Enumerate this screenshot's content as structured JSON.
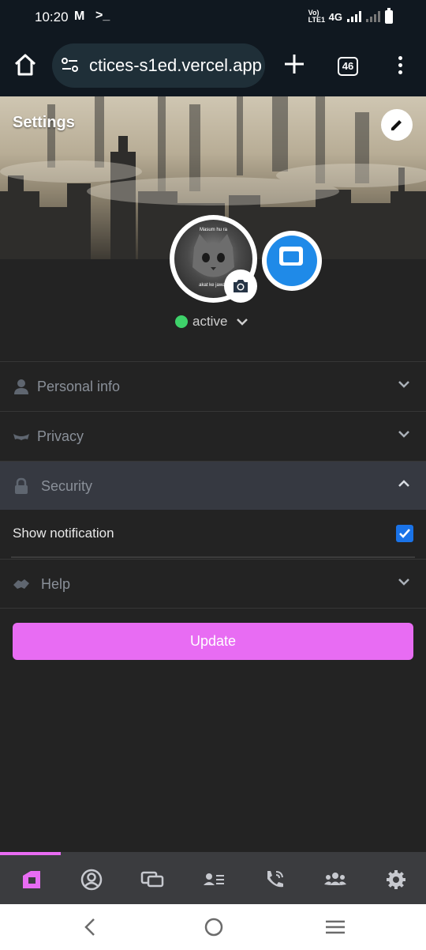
{
  "status_bar": {
    "time": "10:20",
    "network": "4G",
    "volte": "Vo) LTE1"
  },
  "browser": {
    "url": "ctices-s1ed.vercel.app",
    "tab_count": "46"
  },
  "header": {
    "title": "Settings"
  },
  "avatar": {
    "caption_top": "Masum hu ra",
    "caption_bottom": "akat ke jawab"
  },
  "status": {
    "label": "active",
    "color": "#3ed26a"
  },
  "sections": [
    {
      "label": "Personal info",
      "icon": "user-icon",
      "expanded": false
    },
    {
      "label": "Privacy",
      "icon": "mask-icon",
      "expanded": false
    },
    {
      "label": "Security",
      "icon": "lock-icon",
      "expanded": true
    },
    {
      "label": "Help",
      "icon": "handshake-icon",
      "expanded": false
    }
  ],
  "security": {
    "show_notification_label": "Show notification",
    "show_notification_checked": true
  },
  "actions": {
    "update_label": "Update"
  },
  "bottom_nav": [
    "app-logo-icon",
    "profile-icon",
    "chats-icon",
    "contacts-icon",
    "calls-icon",
    "groups-icon",
    "settings-icon"
  ],
  "colors": {
    "accent": "#e86cf3",
    "background": "#232323",
    "checkbox": "#1a73e8"
  }
}
